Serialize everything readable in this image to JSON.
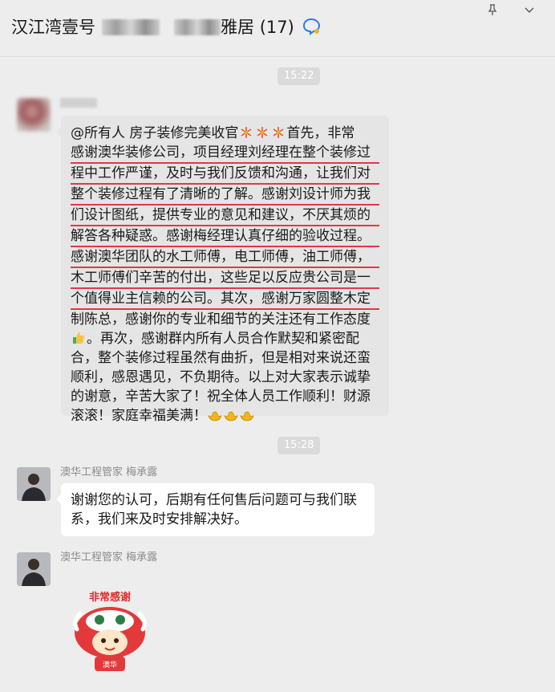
{
  "header": {
    "title_prefix": "汉江湾壹号",
    "title_suffix": "雅居",
    "member_count": "(17)",
    "pin_icon": "pin-icon",
    "more_icon": "more-icon"
  },
  "messages": {
    "time1": "15:22",
    "time2": "15:28",
    "msg1": {
      "lines": [
        "@所有人 房子装修完美收官",
        "首先，非常",
        "感谢澳华装修公司，项目经理刘经理在整个装修过",
        "程中工作严谨，及时与我们反馈和沟通，让我们对",
        "整个装修过程有了清晰的了解。感谢刘设计师为我",
        "们设计图纸，提供专业的意见和建议，不厌其烦的",
        "解答各种疑惑。感谢梅经理认真仔细的验收过程。",
        "感谢澳华团队的水工师傅，电工师傅，油工师傅，",
        "木工师傅们辛苦的付出，这些足以反应贵公司是一",
        "个值得业主信赖的公司。其次，感谢万家圆整木定",
        "制陈总，感谢你的专业和细节的关注还有工作态度",
        "。再次，感谢群内所有人员合作默契和紧密配",
        "合，整个装修过程虽然有曲折，但是相对来说还蛮",
        "顺利，感恩遇见，不负期待。以上对大家表示诚挚",
        "的谢意，辛苦大家了！祝全体人员工作顺利！财源",
        "滚滚！家庭幸福美满！"
      ]
    },
    "msg2": {
      "sender": "澳华工程管家  梅承露",
      "lines": [
        "谢谢您的认可，后期有任何售后问题可与我们联",
        "系，我们来及时安排解决好。"
      ]
    },
    "msg3": {
      "sender": "澳华工程管家  梅承露",
      "sticker_text": "非常感谢",
      "sticker_badge": "澳华"
    }
  }
}
